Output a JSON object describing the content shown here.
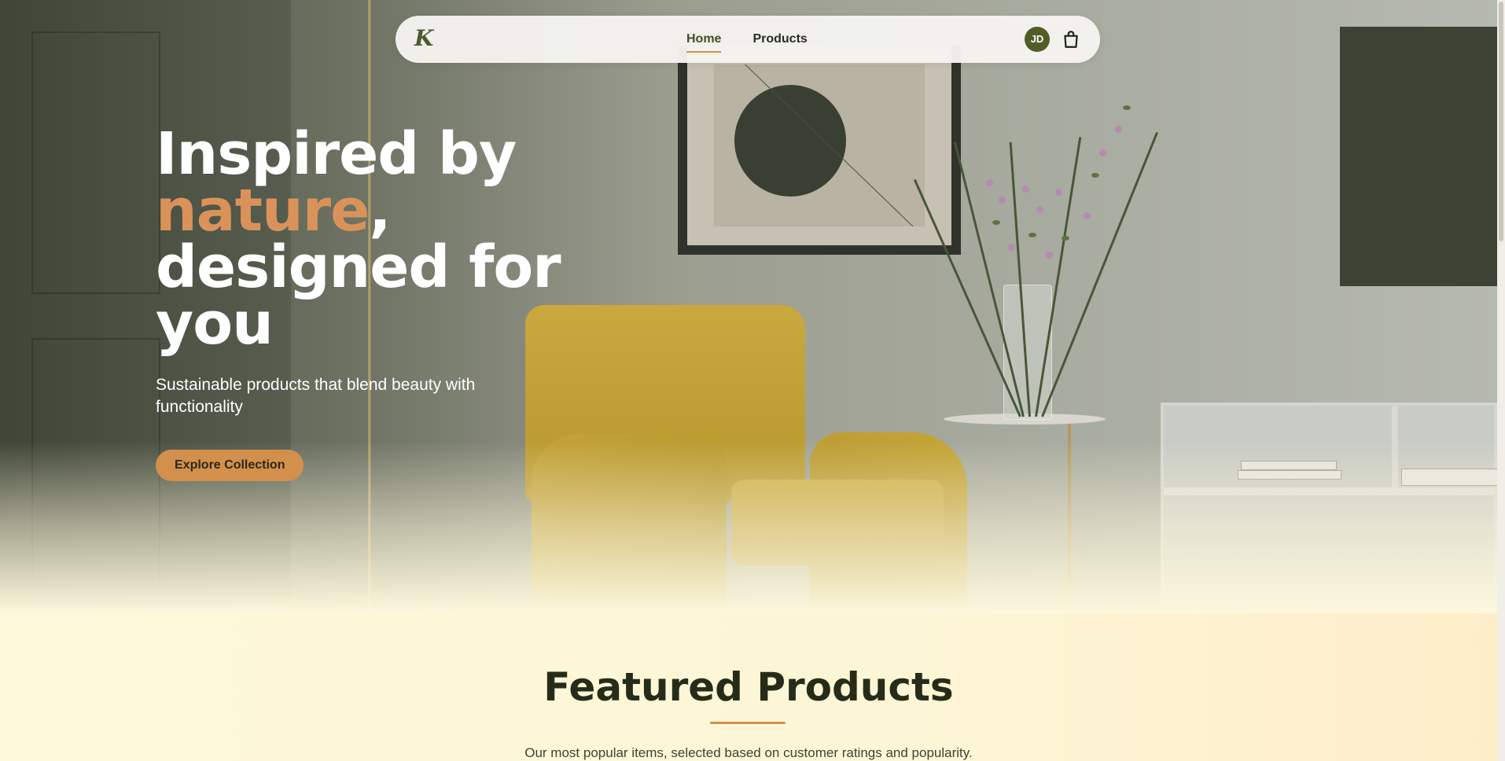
{
  "nav": {
    "logo": "K",
    "links": [
      {
        "label": "Home",
        "active": true
      },
      {
        "label": "Products",
        "active": false
      }
    ],
    "avatar_initials": "JD",
    "cart_icon": "shopping-bag-icon"
  },
  "hero": {
    "title_line1": "Inspired by",
    "title_accent": "nature",
    "title_comma": ",",
    "title_line3": "designed for",
    "title_line4": "you",
    "subtitle": "Sustainable products that blend beauty with functionality",
    "cta_label": "Explore Collection"
  },
  "featured": {
    "title": "Featured Products",
    "subtitle": "Our most popular items, selected based on customer ratings and popularity."
  },
  "colors": {
    "accent": "#d38f4c",
    "brand": "#515c28",
    "heading": "#262c18",
    "background": "#fdf8dc"
  }
}
